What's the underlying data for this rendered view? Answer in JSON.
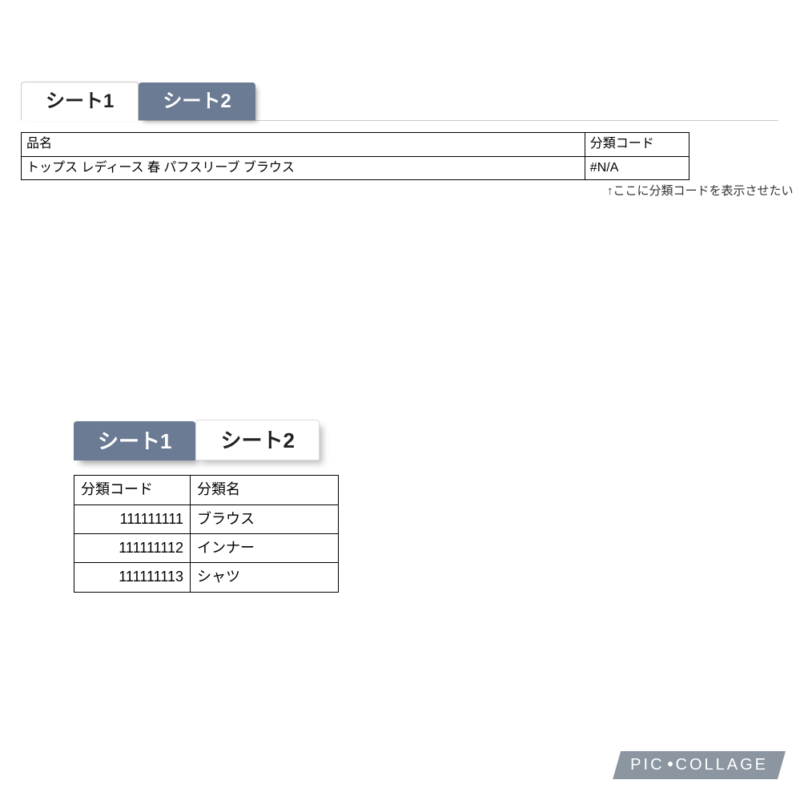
{
  "top": {
    "tabs": {
      "t1": "シート1",
      "t2": "シート2"
    },
    "headers": {
      "name": "品名",
      "code": "分類コード"
    },
    "row": {
      "name": "トップス レディース 春 パフスリーブ ブラウス",
      "code": "#N/A"
    },
    "note": "↑ここに分類コードを表示させたい"
  },
  "bottom": {
    "tabs": {
      "t1": "シート1",
      "t2": "シート2"
    },
    "headers": {
      "code": "分類コード",
      "catname": "分類名"
    },
    "rows": [
      {
        "code": "111111111",
        "name": "ブラウス"
      },
      {
        "code": "111111112",
        "name": "インナー"
      },
      {
        "code": "111111113",
        "name": "シャツ"
      }
    ]
  },
  "watermark": {
    "left": "PIC",
    "right": "COLLAGE"
  }
}
